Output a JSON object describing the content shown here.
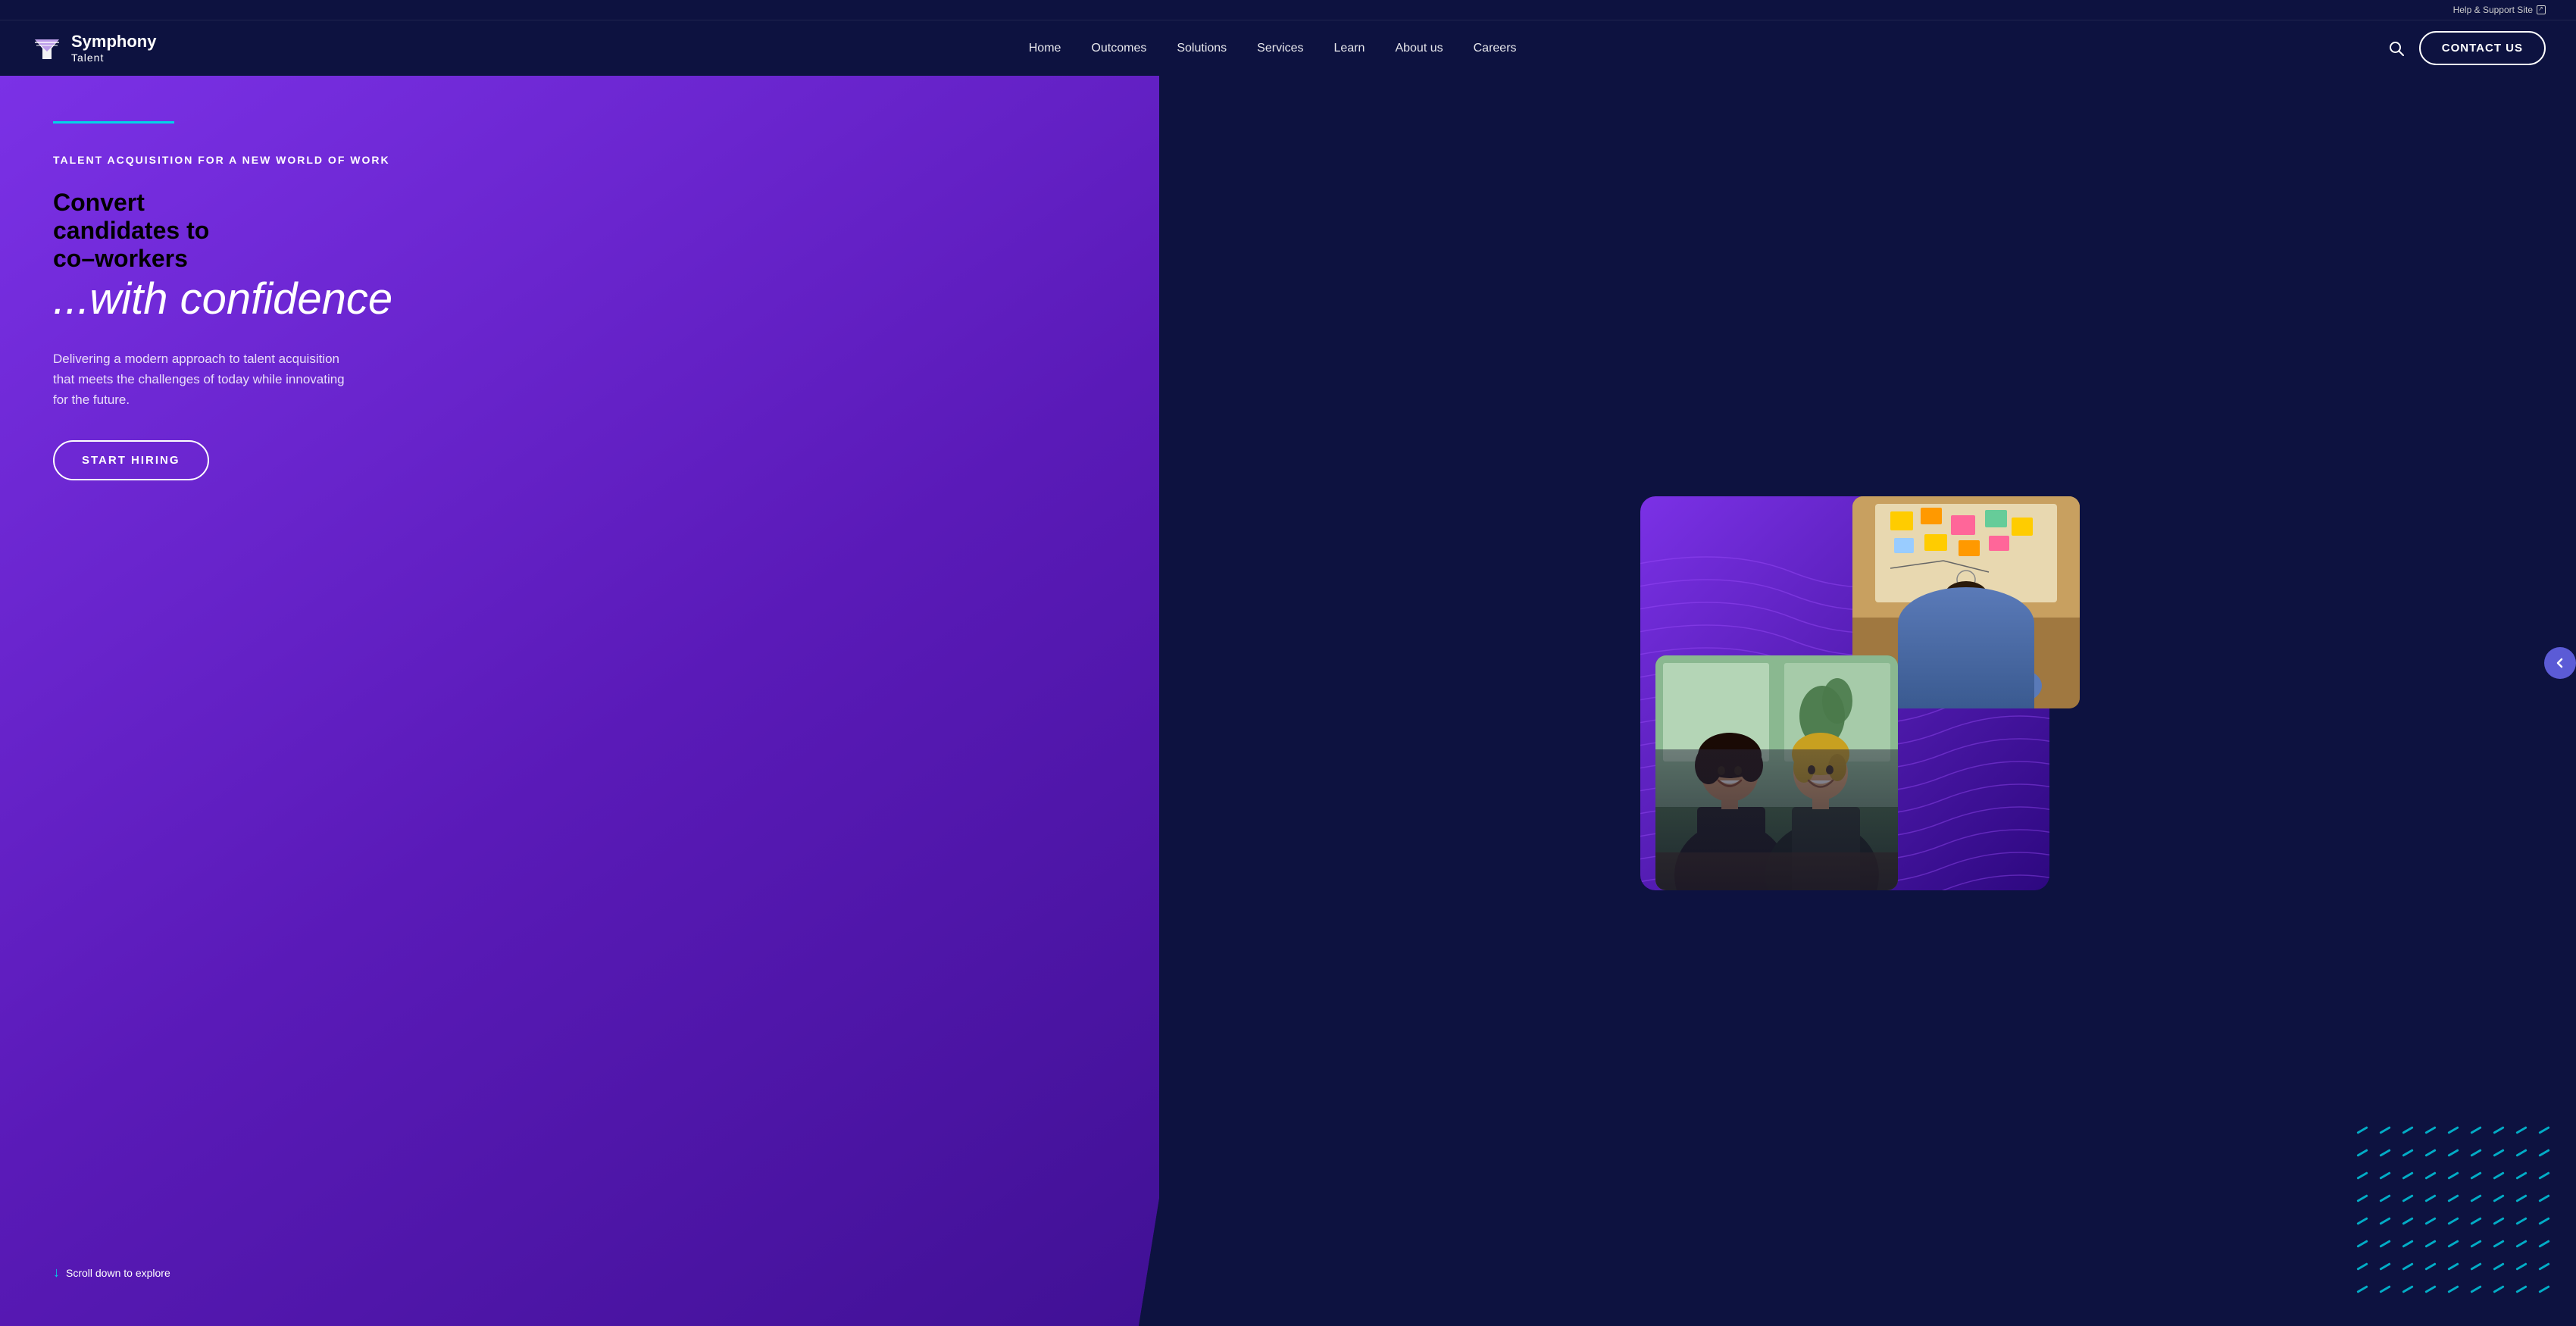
{
  "topbar": {
    "help_link_text": "Help & Support Site",
    "help_link_icon": "external-link-icon"
  },
  "nav": {
    "logo_brand": "Symphony",
    "logo_sub": "Talent",
    "links": [
      {
        "label": "Home",
        "key": "home"
      },
      {
        "label": "Outcomes",
        "key": "outcomes"
      },
      {
        "label": "Solutions",
        "key": "solutions"
      },
      {
        "label": "Services",
        "key": "services"
      },
      {
        "label": "Learn",
        "key": "learn"
      },
      {
        "label": "About us",
        "key": "about"
      },
      {
        "label": "Careers",
        "key": "careers"
      }
    ],
    "contact_button": "CONTACT US",
    "search_aria": "search"
  },
  "hero": {
    "accent_color": "#00d4e8",
    "tagline": "TALENT ACQUISITION FOR A NEW WORLD OF WORK",
    "heading_line1": "Convert",
    "heading_line2": "candidates to",
    "heading_line3": "co–workers",
    "heading_italic": "...with confidence",
    "description": "Delivering a modern approach to talent acquisition that meets the challenges of today while innovating for the future.",
    "cta_button": "START HIRING",
    "scroll_text": "Scroll down to explore",
    "scroll_icon": "down-arrow-icon"
  },
  "sidebar": {
    "button_icon": "chevron-left-icon"
  },
  "colors": {
    "purple_dark": "#0d1240",
    "purple_hero": "#6b21d6",
    "accent_cyan": "#00d4e8",
    "nav_bg": "#0d1240"
  }
}
